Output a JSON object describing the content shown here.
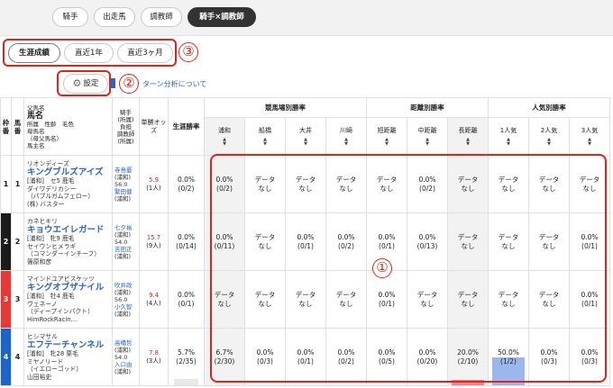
{
  "tabs": [
    "騎手",
    "出走馬",
    "調教師",
    "騎手×調教師"
  ],
  "period_tabs": [
    "生涯成績",
    "直近1年",
    "直近3ヶ月"
  ],
  "settings_label": "設定",
  "link_text": "ターン分析について",
  "callouts": [
    "①",
    "②",
    "③"
  ],
  "header": {
    "waku": "枠番",
    "uma": "馬番",
    "horse_lines": [
      "父馬名",
      "馬名",
      "所属　性齢　毛色",
      "母馬名",
      "（母父馬名）",
      "馬主名"
    ],
    "jockey_lines": [
      "騎手",
      "(所属)",
      "負担",
      "調教師",
      "(所属)"
    ],
    "odds": "単勝オッズ",
    "rate": "生涯勝率",
    "groups": [
      "競馬場別勝率",
      "距離別勝率",
      "人気別勝率"
    ],
    "subcols": [
      "浦和",
      "船橋",
      "大井",
      "川崎",
      "短距離",
      "中距離",
      "長距離",
      "1人気",
      "2人気",
      "3人気"
    ]
  },
  "rows": [
    {
      "waku": "1",
      "waku_bg": "#ffffff",
      "waku_fg": "#222222",
      "uma": "1",
      "horse": [
        "リオンディーズ",
        "キングブルズアイズ",
        "[浦和]　セ5 鹿毛",
        "ダイワデリカシー",
        "（パブルガムフェロー）",
        "(株) バスター"
      ],
      "jockey": [
        "寺島憂",
        "(浦和)",
        "56.0",
        "繁田健",
        "(浦和)"
      ],
      "odds_top": "5.9",
      "odds_bottom": "(1人)",
      "rate_top": "0.0%",
      "rate_bottom": "(0/2)",
      "cells": [
        [
          "0.0%",
          "(0/2)"
        ],
        [
          "データ",
          "なし"
        ],
        [
          "データ",
          "なし"
        ],
        [
          "データ",
          "なし"
        ],
        [
          "データ",
          "なし"
        ],
        [
          "0.0%",
          "(0/2)"
        ],
        [
          "データ",
          "なし"
        ],
        [
          "データ",
          "なし"
        ],
        [
          "データ",
          "なし"
        ],
        [
          "データ",
          "なし"
        ]
      ]
    },
    {
      "waku": "2",
      "waku_bg": "#1b1b1b",
      "waku_fg": "#ffffff",
      "uma": "2",
      "horse": [
        "カネヒキリ",
        "キョウエイレガード",
        "[浦和]　牝9 鹿毛",
        "セイウンヒメラギ",
        "（コマンダーインチーフ）",
        "篠原和彦"
      ],
      "jockey": [
        "七夕裕",
        "(浦和)",
        "54.0",
        "吉田正",
        "(浦和)"
      ],
      "odds_top": "15.7",
      "odds_bottom": "(9人)",
      "rate_top": "0.0%",
      "rate_bottom": "(0/14)",
      "cells": [
        [
          "0.0%",
          "(0/11)"
        ],
        [
          "データ",
          "なし"
        ],
        [
          "0.0%",
          "(0/1)"
        ],
        [
          "0.0%",
          "(0/2)"
        ],
        [
          "0.0%",
          "(0/1)"
        ],
        [
          "0.0%",
          "(0/13)"
        ],
        [
          "データ",
          "なし"
        ],
        [
          "データ",
          "なし"
        ],
        [
          "データ",
          "なし"
        ],
        [
          "0.0%",
          "(0/1)"
        ]
      ]
    },
    {
      "waku": "3",
      "waku_bg": "#e53935",
      "waku_fg": "#ffffff",
      "uma": "3",
      "horse": [
        "マインドユアビスケッツ",
        "キングオブザナイル",
        "[浦和]　牡4 鹿毛",
        "ヴェネーノ",
        "（ディープインパクト）",
        "HimRockRacin…"
      ],
      "jockey": [
        "吹井政",
        "(浦和)",
        "56.0",
        "小久智",
        "(浦和)"
      ],
      "odds_top": "9.4",
      "odds_bottom": "(4人)",
      "rate_top": "0.0%",
      "rate_bottom": "(0/1)",
      "cells": [
        [
          "データ",
          "なし"
        ],
        [
          "データ",
          "なし"
        ],
        [
          "データ",
          "なし"
        ],
        [
          "データ",
          "なし"
        ],
        [
          "0.0%",
          "(0/1)"
        ],
        [
          "データ",
          "なし"
        ],
        [
          "データ",
          "なし"
        ],
        [
          "データ",
          "なし"
        ],
        [
          "データ",
          "なし"
        ],
        [
          "0.0%",
          "(0/1)"
        ]
      ]
    },
    {
      "waku": "4",
      "waku_bg": "#1e63c9",
      "waku_fg": "#ffffff",
      "uma": "4",
      "horse": [
        "ヒシマサル",
        "エフテーチャンネル",
        "[浦和]　牝28 栗毛",
        "ミヤノリード",
        "（イエローゴッド）",
        "山田裕史"
      ],
      "jockey": [
        "高橋哲",
        "(浦和)",
        "54.0",
        "入口由",
        "(浦和)"
      ],
      "odds_top": "7.8",
      "odds_bottom": "(3人)",
      "rate_top": "5.7%",
      "rate_bottom": "(2/35)",
      "cells": [
        [
          "6.7%",
          "(2/30)"
        ],
        [
          "0.0%",
          "(0/3)"
        ],
        [
          "0.0%",
          "(0/1)"
        ],
        [
          "0.0%",
          "(0/2)"
        ],
        [
          "0.0%",
          "(0/5)"
        ],
        [
          "0.0%",
          "(0/20)"
        ],
        [
          "20.0%",
          "(2/10)"
        ],
        [
          "50.0%",
          "(1/2)"
        ],
        [
          "0.0%",
          "(0/3)"
        ],
        [
          "0.0%",
          "(0/3)"
        ]
      ]
    }
  ],
  "bars": {
    "rate_pct": 5.7,
    "long_pct": 20.0,
    "pop1_pct": 50.0
  }
}
